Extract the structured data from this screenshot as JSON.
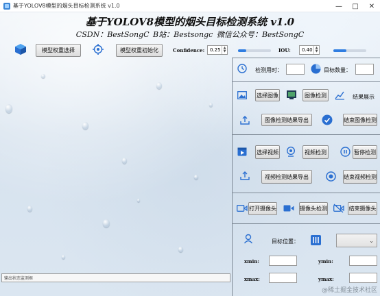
{
  "window": {
    "title": "基于YOLOV8模型的烟头目标检测系统 v1.0",
    "min": "—",
    "max": "□",
    "close": "✕"
  },
  "header": {
    "title": "基于YOLOV8模型的烟头目标检测系统 v1.0",
    "subtitle": "CSDN：BestSongC   B站：Bestsongc   微信公众号：BestSongC"
  },
  "toolbar": {
    "select_weights": "模型权重选择",
    "init_weights": "模型权重初始化",
    "confidence_label": "Confidence:",
    "confidence_value": "0.25",
    "confidence_slider": 0.25,
    "iou_label": "IOU:",
    "iou_value": "0.40",
    "iou_slider": 0.4
  },
  "stats": {
    "time_label": "检测用时：",
    "count_label": "目标数量："
  },
  "image_section": {
    "select_image": "选择图像",
    "detect_image": "图像检测",
    "show_result": "结果展示",
    "export_result": "图像检测结果导出",
    "end_detect": "结束图像检测"
  },
  "video_section": {
    "select_video": "选择视频",
    "detect_video": "视频检测",
    "pause_detect": "暂停检测",
    "export_result": "视频检测结果导出",
    "end_detect": "结束视频检测"
  },
  "camera_section": {
    "open_camera": "打开摄像头",
    "camera_detect": "摄像头检测",
    "close_camera": "结束摄像头"
  },
  "target": {
    "position_label": "目标位置：",
    "xmin": "xmin:",
    "ymin": "ymin:",
    "xmax": "xmax:",
    "ymax": "ymax:"
  },
  "status": {
    "placeholder": "输出状态监测框"
  },
  "watermark": "@稀土掘金技术社区",
  "colors": {
    "accent": "#2f7de1",
    "icon_blue": "#2a6fd1"
  }
}
